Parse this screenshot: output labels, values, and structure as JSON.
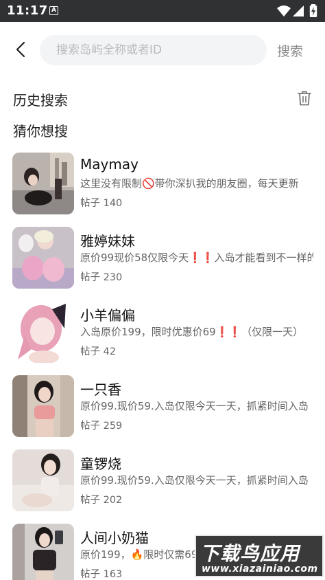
{
  "status_bar": {
    "time": "11:17",
    "notification_icon_letter": "A"
  },
  "search": {
    "placeholder": "搜索岛屿全称或者ID",
    "button_label": "搜索"
  },
  "history": {
    "title": "历史搜索"
  },
  "suggest": {
    "title": "猜你想搜"
  },
  "items": [
    {
      "name": "Maymay",
      "desc": "这里没有限制🚫带你深扒我的朋友圈，每天更新",
      "posts": "帖子 140"
    },
    {
      "name": "雅婷妹妹",
      "desc": "原价99现价58仅限今天❗❗入岛才能看到不一样的我",
      "posts": "帖子 230"
    },
    {
      "name": "小羊偏偏",
      "desc": "入岛原价199，限时优惠价69❗❗（仅限一天）",
      "posts": "帖子 42"
    },
    {
      "name": "一只香",
      "desc": "原价99.现价59.入岛仅限今天一天，抓紧时间入岛",
      "posts": "帖子 259"
    },
    {
      "name": "童锣烧",
      "desc": "原价99.现价59.入岛仅限今天一天，抓紧时间入岛",
      "posts": "帖子 202"
    },
    {
      "name": "人间小奶猫",
      "desc": "原价199，🔥限时仅需69",
      "posts": "帖子 163"
    }
  ],
  "watermark": {
    "main": "下载鸟应用",
    "url": "www.xiazainiao.com"
  },
  "colors": {
    "status_bar": "#2f3133",
    "search_bg": "#f3f4f6",
    "muted_text": "#666666"
  }
}
